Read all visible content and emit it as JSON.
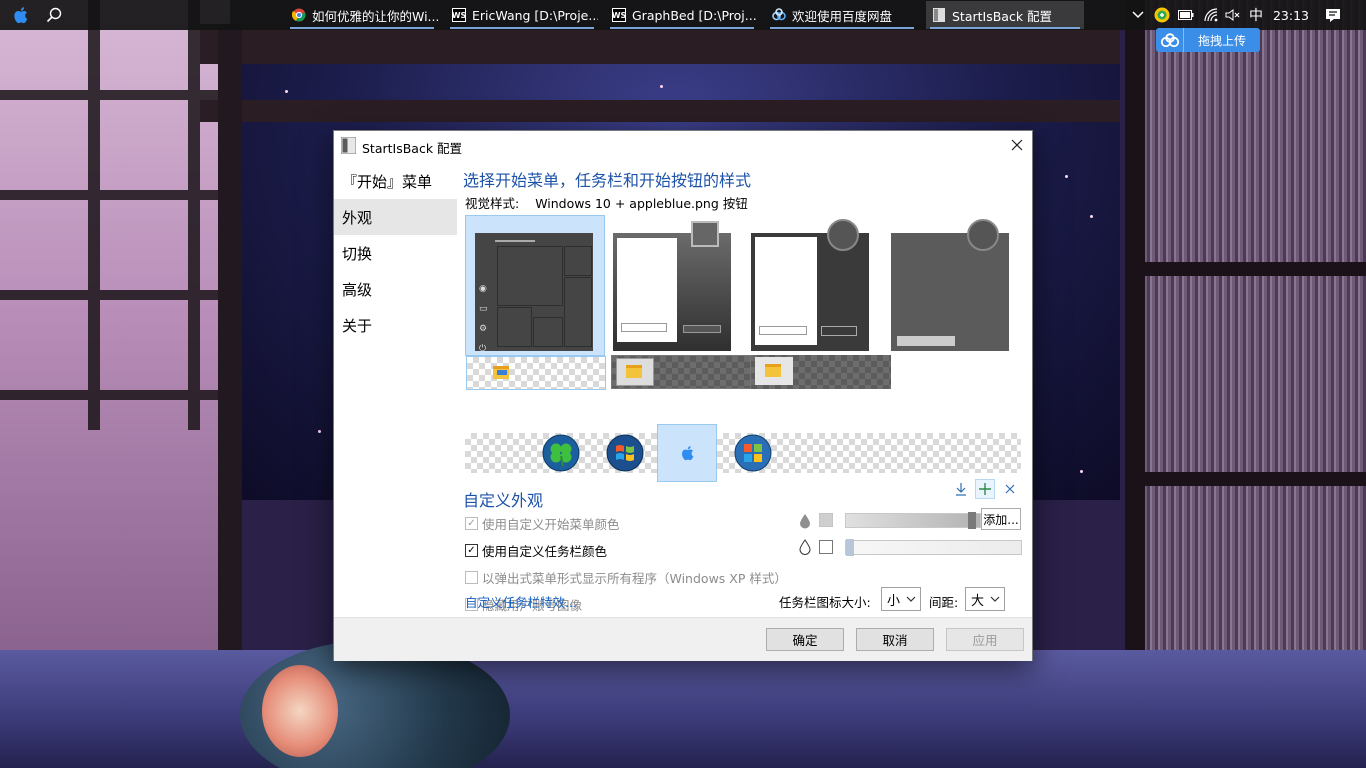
{
  "taskbar": {
    "tasks": [
      {
        "label": "如何优雅的让你的Wi...",
        "icon": "chrome-icon"
      },
      {
        "label": "EricWang [D:\\Proje...",
        "icon": "webstorm-icon"
      },
      {
        "label": "GraphBed [D:\\Proj...",
        "icon": "webstorm-icon"
      },
      {
        "label": "欢迎使用百度网盘",
        "icon": "baidu-netdisk-icon"
      },
      {
        "label": "StartIsBack 配置",
        "icon": "startisback-icon"
      }
    ],
    "ime": "中",
    "clock": "23:13"
  },
  "baidu_float": {
    "label": "拖拽上传"
  },
  "dialog": {
    "title": "StartIsBack 配置",
    "sidebar": [
      {
        "label": "『开始』菜单",
        "selected": false
      },
      {
        "label": "外观",
        "selected": true
      },
      {
        "label": "切换",
        "selected": false
      },
      {
        "label": "高级",
        "selected": false
      },
      {
        "label": "关于",
        "selected": false
      }
    ],
    "heading": "选择开始菜单，任务栏和开始按钮的样式",
    "visual_style_label": "视觉样式:",
    "visual_style_value": "Windows 10 + appleblue.png 按钮",
    "custom_heading": "自定义外观",
    "options": [
      {
        "label": "使用自定义开始菜单颜色",
        "checked": true,
        "enabled": false
      },
      {
        "label": "使用自定义任务栏颜色",
        "checked": true,
        "enabled": true
      },
      {
        "label": "以弹出式菜单形式显示所有程序（Windows XP 样式）",
        "checked": false,
        "enabled": false
      },
      {
        "label": "隐藏用户账号图像",
        "checked": false,
        "enabled": false
      }
    ],
    "add_button": "添加...",
    "start_menu_color_level": 0.97,
    "taskbar_color_level": 0.0,
    "link": "自定义任务栏特效...",
    "icon_size_label": "任务栏图标大小:",
    "icon_size_value": "小",
    "spacing_label": "间距:",
    "spacing_value": "大",
    "buttons": {
      "ok": "确定",
      "cancel": "取消",
      "apply": "应用"
    }
  }
}
